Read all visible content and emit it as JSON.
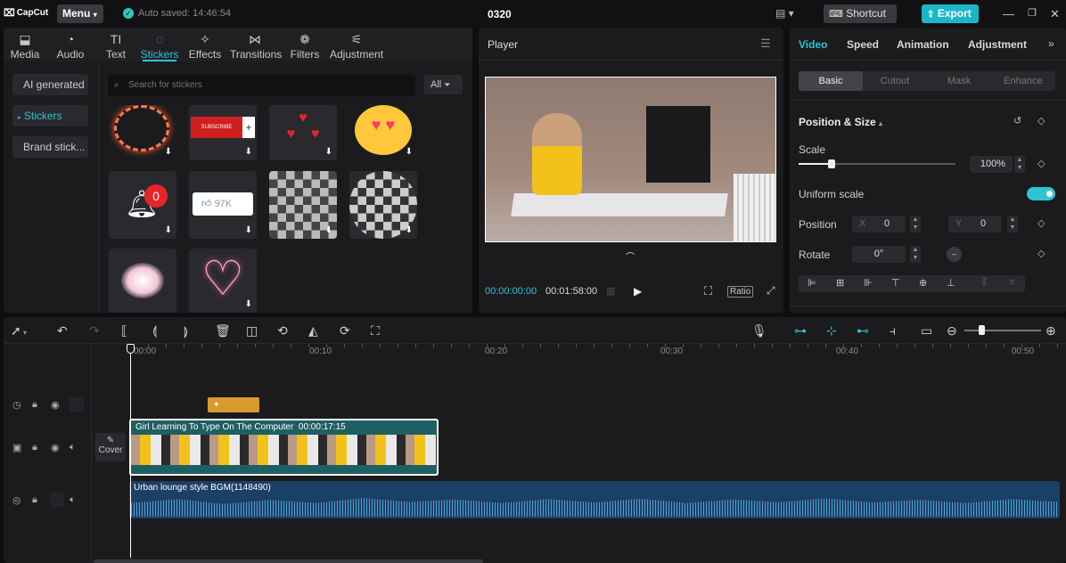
{
  "app": {
    "name": "CapCut",
    "menu": "Menu",
    "autosave": "Auto saved: 14:46:54",
    "project": "0320",
    "shortcut": "Shortcut",
    "export": "Export"
  },
  "media_tabs": [
    {
      "label": "Media",
      "icon": "media-icon"
    },
    {
      "label": "Audio",
      "icon": "audio-icon"
    },
    {
      "label": "Text",
      "icon": "text-icon"
    },
    {
      "label": "Stickers",
      "icon": "stickers-icon",
      "active": true
    },
    {
      "label": "Effects",
      "icon": "effects-icon"
    },
    {
      "label": "Transitions",
      "icon": "transitions-icon"
    },
    {
      "label": "Filters",
      "icon": "filters-icon"
    },
    {
      "label": "Adjustment",
      "icon": "adjustment-icon"
    }
  ],
  "sidebar": {
    "items": [
      {
        "label": "AI generated"
      },
      {
        "label": "Stickers",
        "active": true
      },
      {
        "label": "Brand stick..."
      }
    ]
  },
  "search": {
    "placeholder": "Search for stickers",
    "filter": "All"
  },
  "stickers": [
    {
      "name": "fire-scribble-sticker",
      "text": ""
    },
    {
      "name": "subscribe-sticker",
      "text": "SUBSCRIBE"
    },
    {
      "name": "hearts-sticker",
      "text": ""
    },
    {
      "name": "heart-eyes-emoji-sticker",
      "text": ""
    },
    {
      "name": "notification-bell-sticker",
      "text": "0"
    },
    {
      "name": "like-counter-sticker",
      "text": "97K"
    },
    {
      "name": "mosaic-square-sticker",
      "text": ""
    },
    {
      "name": "mosaic-circle-sticker",
      "text": ""
    },
    {
      "name": "butterfly-sticker",
      "text": ""
    },
    {
      "name": "neon-heart-sticker",
      "text": ""
    }
  ],
  "player": {
    "title": "Player",
    "current_time": "00:00:00:00",
    "total_time": "00:01:58:00",
    "ratio": "Ratio"
  },
  "props": {
    "tabs": [
      {
        "label": "Video",
        "active": true
      },
      {
        "label": "Speed"
      },
      {
        "label": "Animation"
      },
      {
        "label": "Adjustment"
      }
    ],
    "subtabs": [
      {
        "label": "Basic",
        "active": true
      },
      {
        "label": "Cutout"
      },
      {
        "label": "Mask"
      },
      {
        "label": "Enhance"
      }
    ],
    "section": "Position & Size",
    "scale_label": "Scale",
    "scale_value": "100%",
    "scale_level": 0.1,
    "uniform_label": "Uniform scale",
    "uniform_on": true,
    "position_label": "Position",
    "x_label": "X",
    "x_value": "0",
    "y_label": "Y",
    "y_value": "0",
    "rotate_label": "Rotate",
    "rotate_value": "0°"
  },
  "timeline": {
    "ticks": [
      "00:00",
      "00:10",
      "00:20",
      "00:30",
      "00:40",
      "00:50"
    ],
    "cover_label": "Cover",
    "video_clip": {
      "title": "Girl Learning To Type On The Computer",
      "duration": "00:00:17:15"
    },
    "audio_clip": {
      "title": "Urban lounge style BGM(1148490)"
    }
  },
  "colors": {
    "accent": "#2ec4d4",
    "export": "#1bb7c8",
    "video_clip": "#1f5f63",
    "audio_clip": "#1c3f66",
    "sticker_clip": "#d99a2b"
  }
}
